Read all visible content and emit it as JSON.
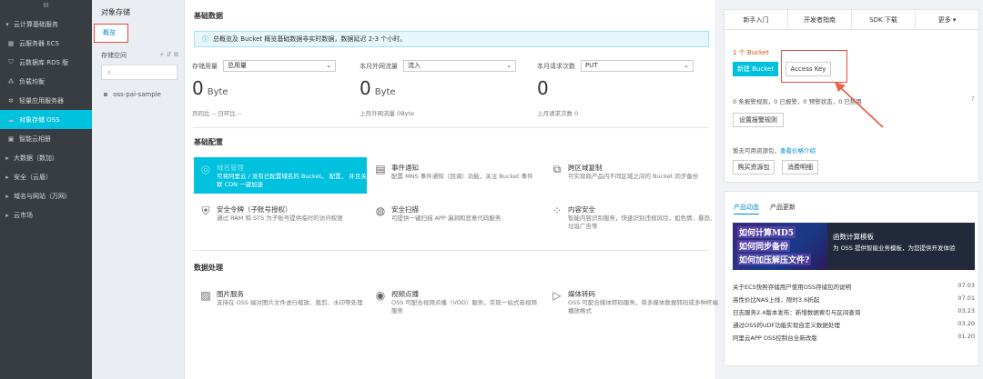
{
  "sidebar": {
    "top": "III",
    "items": [
      {
        "label": "云计算基础服务",
        "icon": "caret-down",
        "group": true
      },
      {
        "label": "云服务器 ECS",
        "icon": "grid"
      },
      {
        "label": "云数据库 RDS 版",
        "icon": "shield"
      },
      {
        "label": "负载均衡",
        "icon": "nodes"
      },
      {
        "label": "轻量应用服务器",
        "icon": "gear"
      },
      {
        "label": "对象存储 OSS",
        "icon": "cloud",
        "active": true
      },
      {
        "label": "智能云相册",
        "icon": "album"
      },
      {
        "label": "大数据（数加）",
        "icon": "caret-right",
        "group": true
      },
      {
        "label": "安全（云盾）",
        "icon": "caret-right",
        "group": true
      },
      {
        "label": "域名与网站（万网）",
        "icon": "caret-right",
        "group": true
      },
      {
        "label": "云市场",
        "icon": "caret-right",
        "group": true
      }
    ]
  },
  "subpanel": {
    "title": "对象存储",
    "overview": "概览",
    "space_label": "存储空间",
    "space_actions": "+ ⇵ ⧉",
    "search_icon": "⌕",
    "bucket": "oss-pai-sample"
  },
  "main": {
    "basic_title": "基础数据",
    "info": "总概览及 Bucket 概览基础数据非实时数据，数据延迟 2-3 个小时。",
    "stats": [
      {
        "label": "存储用量",
        "select": "总用量",
        "value": "0",
        "unit": "Byte",
        "foot": "月同比 --   日环比 --"
      },
      {
        "label": "本月外网流量",
        "select": "流入",
        "value": "0",
        "unit": "Byte",
        "foot": "上月外网流量  0Byte"
      },
      {
        "label": "本月请求次数",
        "select": "PUT",
        "value": "0",
        "unit": "",
        "foot": "上月请求次数  0"
      }
    ],
    "config_title": "基础配置",
    "config_cards": [
      {
        "title": "域名管理",
        "desc": "可将阿里云 / 没有已配置域名的 Bucket。 配置， 并且关联 CDN 一键加速",
        "icon": "globe",
        "highlight": true
      },
      {
        "title": "事件通知",
        "desc": "配置 MNS 事件通知（回调）功能，关注 Bucket 事件",
        "icon": "doc"
      },
      {
        "title": "跨区域复制",
        "desc": "可实现跨产品内不同区域之间的 Bucket 同步备份",
        "icon": "copy"
      },
      {
        "title": "安全令牌（子账号授权）",
        "desc": "通过 RAM 和 STS 为子账号提供临时的访问权限",
        "icon": "shield-check"
      },
      {
        "title": "安全扫描",
        "desc": "可提供一键扫描 APP 漏洞和恶意代码服务",
        "icon": "scan"
      },
      {
        "title": "内容安全",
        "desc": "智能内容识别服务，快速识别违规风险，如色情、暴恐、垃圾广告等",
        "icon": "network"
      }
    ],
    "process_title": "数据处理",
    "process_cards": [
      {
        "title": "图片服务",
        "desc": "支持在 OSS 端对图片文件进行缩放、裁剪、水印等处理",
        "icon": "image"
      },
      {
        "title": "视频点播",
        "desc": "OSS 可配合视频点播（VOD）服务，实现一站式音视频服务",
        "icon": "video"
      },
      {
        "title": "媒体转码",
        "desc": "OSS 可配合媒体转码服务，将多媒体数据转码成多种终端播放格式",
        "icon": "play"
      }
    ]
  },
  "right": {
    "tabs": [
      "新手入门",
      "开发者指南",
      "SDK 下载",
      "更多 ▾"
    ],
    "bucket_count": "1 个 Bucket",
    "new_bucket": "新建 Bucket",
    "access_key": "Access Key",
    "alarm_text": "0 条报警规则，0 已报警，0 预警状态，0 已禁用",
    "alarm_btn": "设置报警规则",
    "help": "?",
    "resource_text": "暂无可用资源包，",
    "price_link": "查看价格介绍",
    "buy_btn": "购买资源包",
    "detail_btn": "消费明细",
    "news_tabs": [
      "产品动态",
      "产品更新"
    ],
    "banner_lines": [
      "如何计算MD5",
      "如何同步备份",
      "如何加压解压文件?"
    ],
    "banner_title": "函数计算模板",
    "banner_desc": "为 OSS 提供智能业务模板，为您提供开发体验",
    "news": [
      {
        "text": "关于ECS快照存储用户使用OSS存储包的说明",
        "date": "07.03"
      },
      {
        "text": "高性价比NAS上线，限时3.6折起",
        "date": "07.01"
      },
      {
        "text": "日志服务2.4版本发布：新增数据索引与区间查询",
        "date": "03.23"
      },
      {
        "text": "通过OSS的UDF功能实现自定义数据处理",
        "date": "03.20"
      },
      {
        "text": "阿里云APP OSS控制台全新改版",
        "date": "01.20"
      }
    ]
  }
}
